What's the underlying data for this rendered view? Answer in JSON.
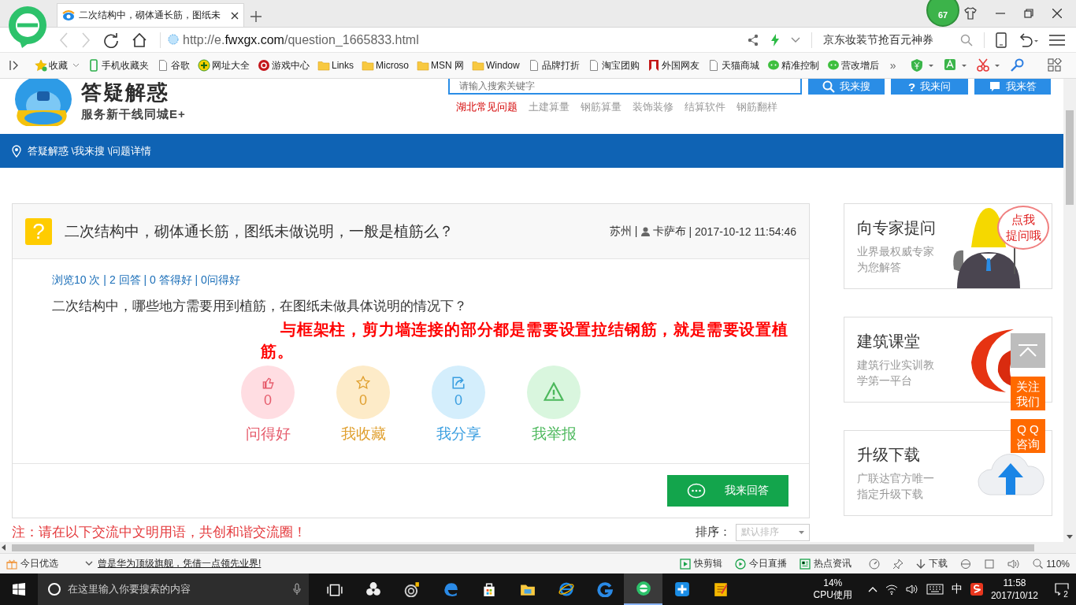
{
  "browser": {
    "tab": {
      "title": "二次结构中，砌体通长筋，图纸未",
      "selected": true
    },
    "badge": "67",
    "address": {
      "prefix": "http://e.",
      "domain": "fwxgx.com",
      "path": "/question_1665833.html"
    },
    "search_hint": "京东妆装节抢百元神券",
    "bookmarks": [
      {
        "kind": "star",
        "label": "收藏"
      },
      {
        "kind": "phone",
        "label": "手机收藏夹"
      },
      {
        "kind": "page",
        "label": "谷歌"
      },
      {
        "kind": "plus",
        "label": "网址大全"
      },
      {
        "kind": "game",
        "label": "游戏中心"
      },
      {
        "kind": "folder",
        "label": "Links"
      },
      {
        "kind": "folder",
        "label": "Microso"
      },
      {
        "kind": "folder",
        "label": "MSN 网"
      },
      {
        "kind": "folder",
        "label": "Window"
      },
      {
        "kind": "page",
        "label": "品牌打折"
      },
      {
        "kind": "page",
        "label": "淘宝团购"
      },
      {
        "kind": "flag",
        "label": "外国网友"
      },
      {
        "kind": "page",
        "label": "天猫商城"
      },
      {
        "kind": "chat",
        "label": "精准控制"
      },
      {
        "kind": "chat",
        "label": "营改增后"
      }
    ],
    "bookmarks_more": "»"
  },
  "page": {
    "logo": {
      "title": "答疑解惑",
      "subtitle": "服务新干线同城E+"
    },
    "search": {
      "placeholder": "请输入搜索关键字"
    },
    "header_buttons": [
      {
        "kind": "search",
        "label": "我来搜"
      },
      {
        "kind": "ask",
        "glyph": "?",
        "label": "我来问"
      },
      {
        "kind": "answer",
        "label": "我来答"
      }
    ],
    "tags": [
      {
        "label": "湖北常见问题",
        "selected": true
      },
      {
        "label": "土建算量",
        "selected": false
      },
      {
        "label": "钢筋算量",
        "selected": false
      },
      {
        "label": "装饰装修",
        "selected": false
      },
      {
        "label": "结算软件",
        "selected": false
      },
      {
        "label": "钢筋翻样",
        "selected": false
      }
    ],
    "breadcrumb": "答疑解惑 \\我来搜 \\问题详情",
    "question": {
      "icon_glyph": "?",
      "title": "二次结构中，砌体通长筋，图纸未做说明，一般是植筋么？",
      "location": "苏州 |",
      "author": "卡萨布",
      "date": "| 2017-10-12 11:54:46",
      "stats": "浏览10 次 | 2 回答 | 0 答得好 | 0问得好",
      "body": "二次结构中，哪些地方需要用到植筋，在图纸未做具体说明的情况下？",
      "annotation": "与框架柱，剪力墙连接的部分都是需要设置拉结钢筋，就是需要设置植筋。",
      "actions": [
        {
          "kind": "like",
          "count": "0",
          "label": "问得好"
        },
        {
          "kind": "favorite",
          "count": "0",
          "label": "我收藏"
        },
        {
          "kind": "share",
          "count": "0",
          "label": "我分享"
        },
        {
          "kind": "report",
          "label": "我举报"
        }
      ],
      "answer_button": "我来回答"
    },
    "notice": "注：请在以下交流中文明用语，共创和谐交流圈！",
    "sort": {
      "label": "排序：",
      "value": "默认排序"
    },
    "sidebar": [
      {
        "kind": "expert",
        "title": "向专家提问",
        "lines": [
          "业界最权威专家",
          "为您解答"
        ],
        "bubble": [
          "点我",
          "提问哦"
        ]
      },
      {
        "kind": "course",
        "title": "建筑课堂",
        "lines": [
          "建筑行业实训教",
          "学第一平台"
        ]
      },
      {
        "kind": "download",
        "title": "升级下载",
        "lines": [
          "广联达官方唯一",
          "指定升级下载"
        ]
      }
    ],
    "float_tools": [
      {
        "kind": "top"
      },
      {
        "kind": "text",
        "lines": [
          "关注",
          "我们"
        ]
      },
      {
        "kind": "text",
        "lines": [
          "Q Q",
          "咨询"
        ]
      }
    ]
  },
  "status_bar": {
    "picks": "今日优选",
    "news": "曾是华为顶级旗舰，凭借一点领先业界!",
    "items": [
      {
        "kind": "play",
        "label": "快剪辑"
      },
      {
        "kind": "live",
        "label": "今日直播"
      },
      {
        "kind": "news",
        "label": "热点资讯"
      }
    ],
    "download": "下载",
    "zoom": "110%"
  },
  "taskbar": {
    "search_placeholder": "在这里输入你要搜索的内容",
    "cpu_value": "14%",
    "cpu_label": "CPU使用",
    "ime": "中",
    "time": "11:58",
    "date": "2017/10/12",
    "notifications": "2"
  }
}
